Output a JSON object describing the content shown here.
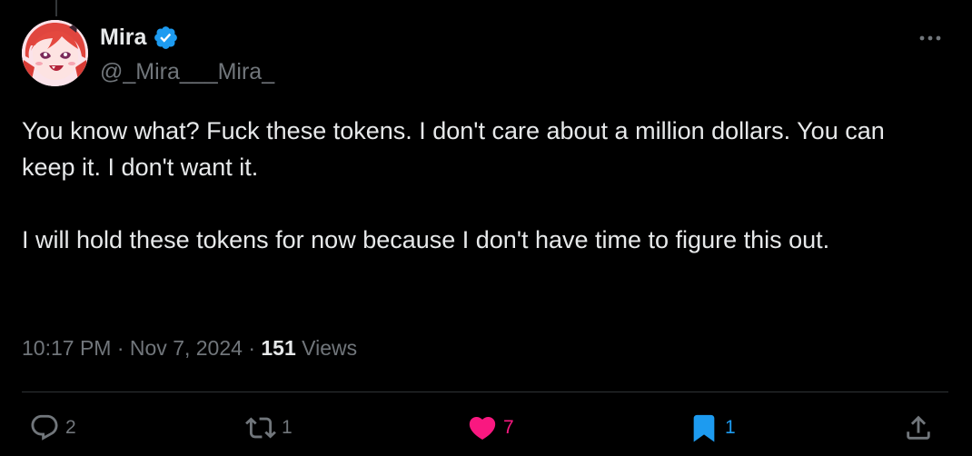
{
  "tweet": {
    "author": {
      "display_name": "Mira",
      "handle": "@_Mira___Mira_",
      "verified": true
    },
    "text": {
      "paragraph1": "You know what? Fuck these tokens. I don't care about a million dollars. You can keep it. I don't want it.",
      "paragraph2": "I will hold these tokens for now because I don't have time to figure this out."
    },
    "meta": {
      "time": "10:17 PM",
      "separator1": " · ",
      "date": "Nov 7, 2024",
      "separator2": " · ",
      "views_count": "151",
      "views_label": " Views"
    },
    "actions": {
      "reply_count": "2",
      "repost_count": "1",
      "like_count": "7",
      "bookmark_count": "1"
    }
  },
  "icons": {
    "verified": "verified-badge-icon",
    "more": "more-horizontal-icon",
    "reply": "reply-icon",
    "repost": "repost-icon",
    "like": "heart-icon",
    "bookmark": "bookmark-icon",
    "share": "share-icon"
  },
  "colors": {
    "background": "#000000",
    "primary_text": "#e7e9ea",
    "secondary_text": "#71767b",
    "like_active": "#f91880",
    "bookmark_active": "#1d9bf0",
    "verified": "#1d9bf0",
    "divider": "#2f3336"
  }
}
